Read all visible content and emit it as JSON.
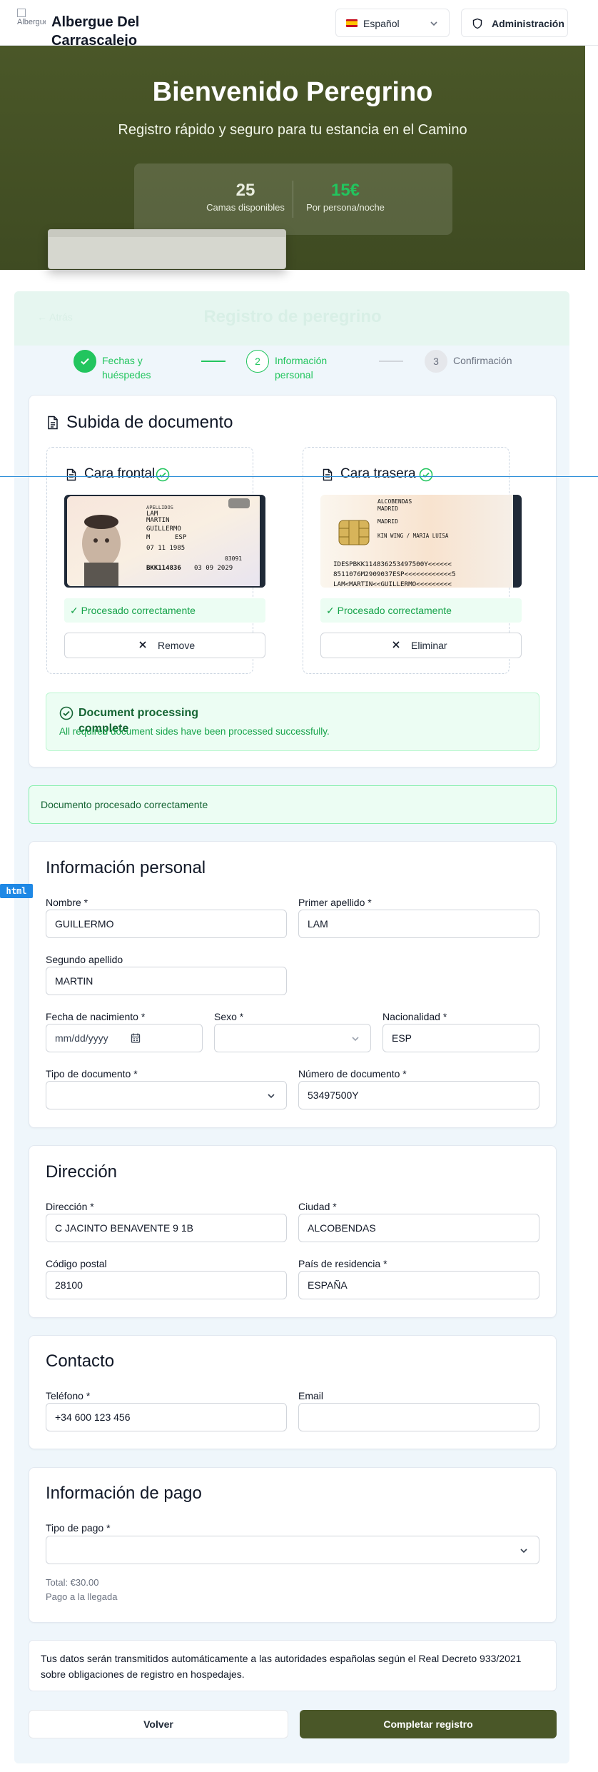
{
  "header": {
    "logo_alt": "Albergue",
    "brand": "Albergue Del Carrascalejo",
    "language": "Español",
    "admin_label": "Administración"
  },
  "hero": {
    "title": "Bienvenido Peregrino",
    "subtitle": "Registro rápido y seguro para tu estancia en el Camino",
    "beds_value": "25",
    "beds_label": "Camas disponibles",
    "price_value": "15€",
    "price_label": "Por persona/noche"
  },
  "registration": {
    "back_label": "← Atrás",
    "title": "Registro de peregrino"
  },
  "steps": [
    {
      "number": "✓",
      "label": "Fechas y huéspedes",
      "state": "done"
    },
    {
      "number": "2",
      "label": "Información personal",
      "state": "active"
    },
    {
      "number": "3",
      "label": "Confirmación",
      "state": "pending"
    }
  ],
  "upload": {
    "title": "Subida de documento",
    "front": {
      "label": "Cara frontal",
      "status": "✓ Procesado correctamente",
      "remove": "Remove",
      "card": {
        "surname1": "LAM",
        "surname2": "MARTIN",
        "name": "GUILLERMO",
        "sex": "M",
        "nationality": "ESP",
        "dob": "07 11 1985",
        "idesp": "BKK114836",
        "expiry": "03 09 2029",
        "code": "03091"
      }
    },
    "back": {
      "label": "Cara trasera",
      "status": "✓ Procesado correctamente",
      "remove": "Eliminar",
      "card": {
        "city": "ALCOBENDAS",
        "province": "MADRID",
        "place": "MADRID",
        "parents": "KIN WING / MARIA LUISA",
        "mrz1": "IDESPBKK114836253497500Y<<<<<<",
        "mrz2": "8511076M2909037ESP<<<<<<<<<<<<5",
        "mrz3": "LAM<MARTIN<<GUILLERMO<<<<<<<<<"
      }
    },
    "processing_title": "Document processing complete",
    "processing_desc": "All required document sides have been processed successfully."
  },
  "alert_success": "Documento procesado correctamente",
  "personal": {
    "title": "Información personal",
    "nombre_label": "Nombre *",
    "nombre": "GUILLERMO",
    "apellido1_label": "Primer apellido *",
    "apellido1": "LAM",
    "apellido2_label": "Segundo apellido",
    "apellido2": "MARTIN",
    "fecha_label": "Fecha de nacimiento *",
    "fecha_placeholder": "mm/dd/yyyy",
    "sexo_label": "Sexo *",
    "sexo": "",
    "nacionalidad_label": "Nacionalidad *",
    "nacionalidad": "ESP",
    "tipo_doc_label": "Tipo de documento *",
    "tipo_doc": "",
    "num_doc_label": "Número de documento *",
    "num_doc": "53497500Y"
  },
  "address": {
    "title": "Dirección",
    "direccion_label": "Dirección *",
    "direccion": "C JACINTO BENAVENTE 9 1B",
    "ciudad_label": "Ciudad *",
    "ciudad": "ALCOBENDAS",
    "cp_label": "Código postal",
    "cp": "28100",
    "pais_label": "País de residencia *",
    "pais": "ESPAÑA"
  },
  "contact": {
    "title": "Contacto",
    "telefono_label": "Teléfono *",
    "telefono": "+34 600 123 456",
    "email_label": "Email",
    "email": ""
  },
  "payment": {
    "title": "Información de pago",
    "tipo_label": "Tipo de pago *",
    "tipo": "",
    "total": "Total: €30.00",
    "pay_note": "Pago a la llegada"
  },
  "legal_note": "Tus datos serán transmitidos automáticamente a las autoridades españolas según el Real Decreto 933/2021 sobre obligaciones de registro en hospedajes.",
  "actions": {
    "back": "Volver",
    "submit": "Completar registro"
  },
  "devtools_tag": "html",
  "colors": {
    "brand": "#4a5728",
    "success": "#22c55e",
    "success_text": "#16a34a",
    "price": "#22c55e"
  }
}
